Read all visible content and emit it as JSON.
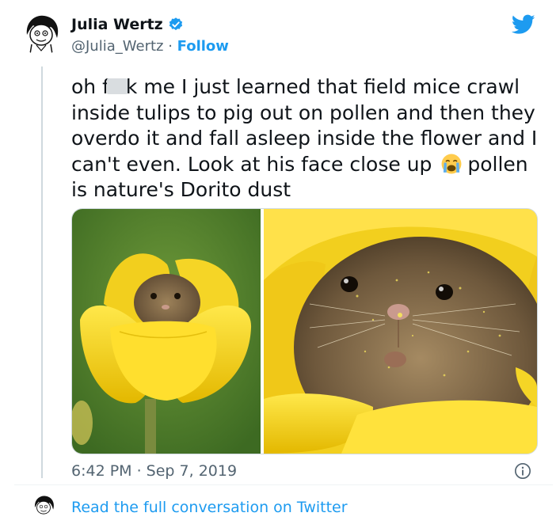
{
  "author": {
    "name": "Julia Wertz",
    "handle": "@Julia_Wertz",
    "separator": " · ",
    "follow_label": "Follow",
    "verified": true
  },
  "tweet": {
    "text_part1": "oh f",
    "text_part2": "k me I just learned that field mice crawl inside tulips to pig out on pollen and then they overdo it and fall asleep inside the flower and I can't even. Look at his face close up",
    "text_part3": "pollen is nature's Dorito dust",
    "emoji": "loudly-crying-face",
    "timestamp": "6:42 PM · Sep 7, 2019"
  },
  "footer": {
    "read_more_label": "Read the full conversation on Twitter"
  },
  "colors": {
    "accent": "#1d9bf0",
    "text": "#0f1419",
    "muted": "#536471"
  }
}
